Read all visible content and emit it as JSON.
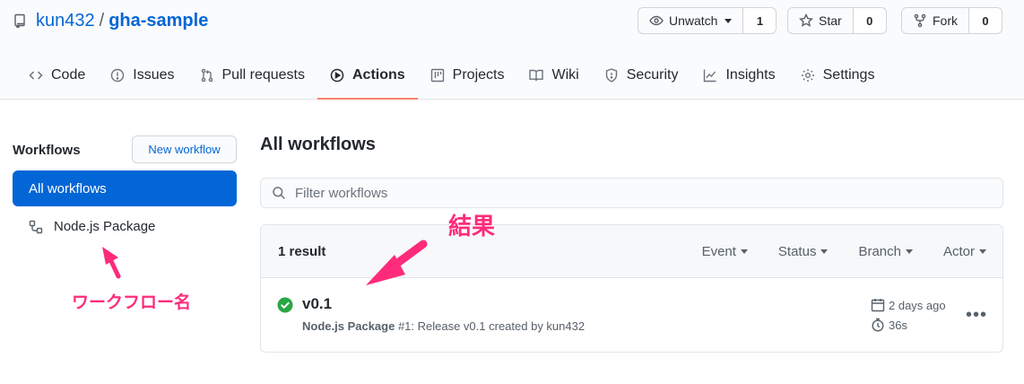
{
  "repo": {
    "owner": "kun432",
    "separator": "/",
    "name": "gha-sample"
  },
  "actions": [
    {
      "label": "Unwatch",
      "count": "1",
      "icon": "eye-icon"
    },
    {
      "label": "Star",
      "count": "0",
      "icon": "star-icon"
    },
    {
      "label": "Fork",
      "count": "0",
      "icon": "fork-icon"
    }
  ],
  "tabs": [
    {
      "label": "Code",
      "icon": "code-icon"
    },
    {
      "label": "Issues",
      "icon": "issue-icon"
    },
    {
      "label": "Pull requests",
      "icon": "pull-request-icon"
    },
    {
      "label": "Actions",
      "icon": "play-icon",
      "active": true
    },
    {
      "label": "Projects",
      "icon": "project-icon"
    },
    {
      "label": "Wiki",
      "icon": "book-icon"
    },
    {
      "label": "Security",
      "icon": "shield-icon"
    },
    {
      "label": "Insights",
      "icon": "graph-icon"
    },
    {
      "label": "Settings",
      "icon": "gear-icon"
    }
  ],
  "sidebar": {
    "heading": "Workflows",
    "new_workflow": "New workflow",
    "all_workflows": "All workflows",
    "workflows": [
      "Node.js Package"
    ]
  },
  "main": {
    "title": "All workflows",
    "filter_placeholder": "Filter workflows",
    "results_count": "1 result",
    "filters": [
      "Event",
      "Status",
      "Branch",
      "Actor"
    ],
    "runs": [
      {
        "title": "v0.1",
        "workflow": "Node.js Package",
        "detail": " #1: Release v0.1 created by kun432",
        "time": "2 days ago",
        "duration": "36s",
        "status": "success"
      }
    ]
  },
  "annotations": {
    "result": "結果",
    "workflow_name": "ワークフロー名"
  },
  "colors": {
    "accent": "#0366d6",
    "active_tab": "#f9826c",
    "success": "#28a745",
    "annotation": "#ff2b7a"
  }
}
